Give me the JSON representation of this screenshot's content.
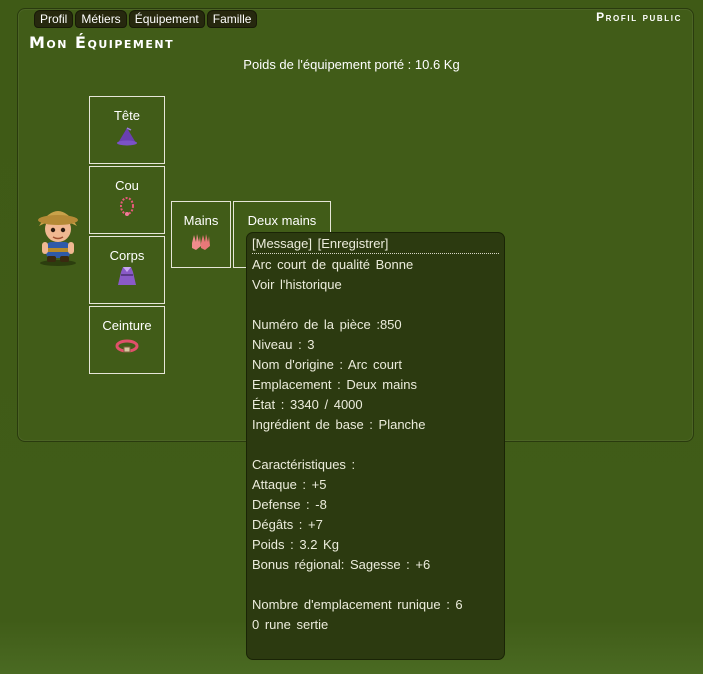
{
  "tabs": [
    "Profil",
    "Métiers",
    "Équipement",
    "Famille"
  ],
  "header": {
    "public_link": "Profil public",
    "title": "Mon Équipement"
  },
  "weight_text": "Poids de l'équipement porté : 10.6 Kg",
  "slots": {
    "tete": {
      "label": "Tête",
      "icon": "wizard-hat-icon"
    },
    "cou": {
      "label": "Cou",
      "icon": "necklace-icon"
    },
    "corps": {
      "label": "Corps",
      "icon": "robe-icon"
    },
    "ceinture": {
      "label": "Ceinture",
      "icon": "belt-icon"
    },
    "mains": {
      "label": "Mains",
      "icon": "gloves-icon"
    },
    "deux_mains": {
      "label": "Deux mains",
      "icon": "bow-icon"
    }
  },
  "tooltip": {
    "message": "[Message]",
    "save": "[Enregistrer]",
    "name": "Arc court de qualité Bonne",
    "history": "Voir l'historique",
    "piece_number": "Numéro de la pièce :850",
    "level": "Niveau : 3",
    "origin": "Nom d'origine : Arc court",
    "location": "Emplacement : Deux mains",
    "state": "État : 3340 / 4000",
    "base_ingredient": "Ingrédient de base : Planche",
    "characteristics": "Caractéristiques :",
    "attack": "Attaque : +5",
    "defense": "Defense : -8",
    "damage": "Dégâts : +7",
    "weight": "Poids : 3.2 Kg",
    "regional_bonus": "Bonus régional: Sagesse : +6",
    "rune_slots": "Nombre d'emplacement runique : 6",
    "runes_set": "0 rune sertie"
  }
}
